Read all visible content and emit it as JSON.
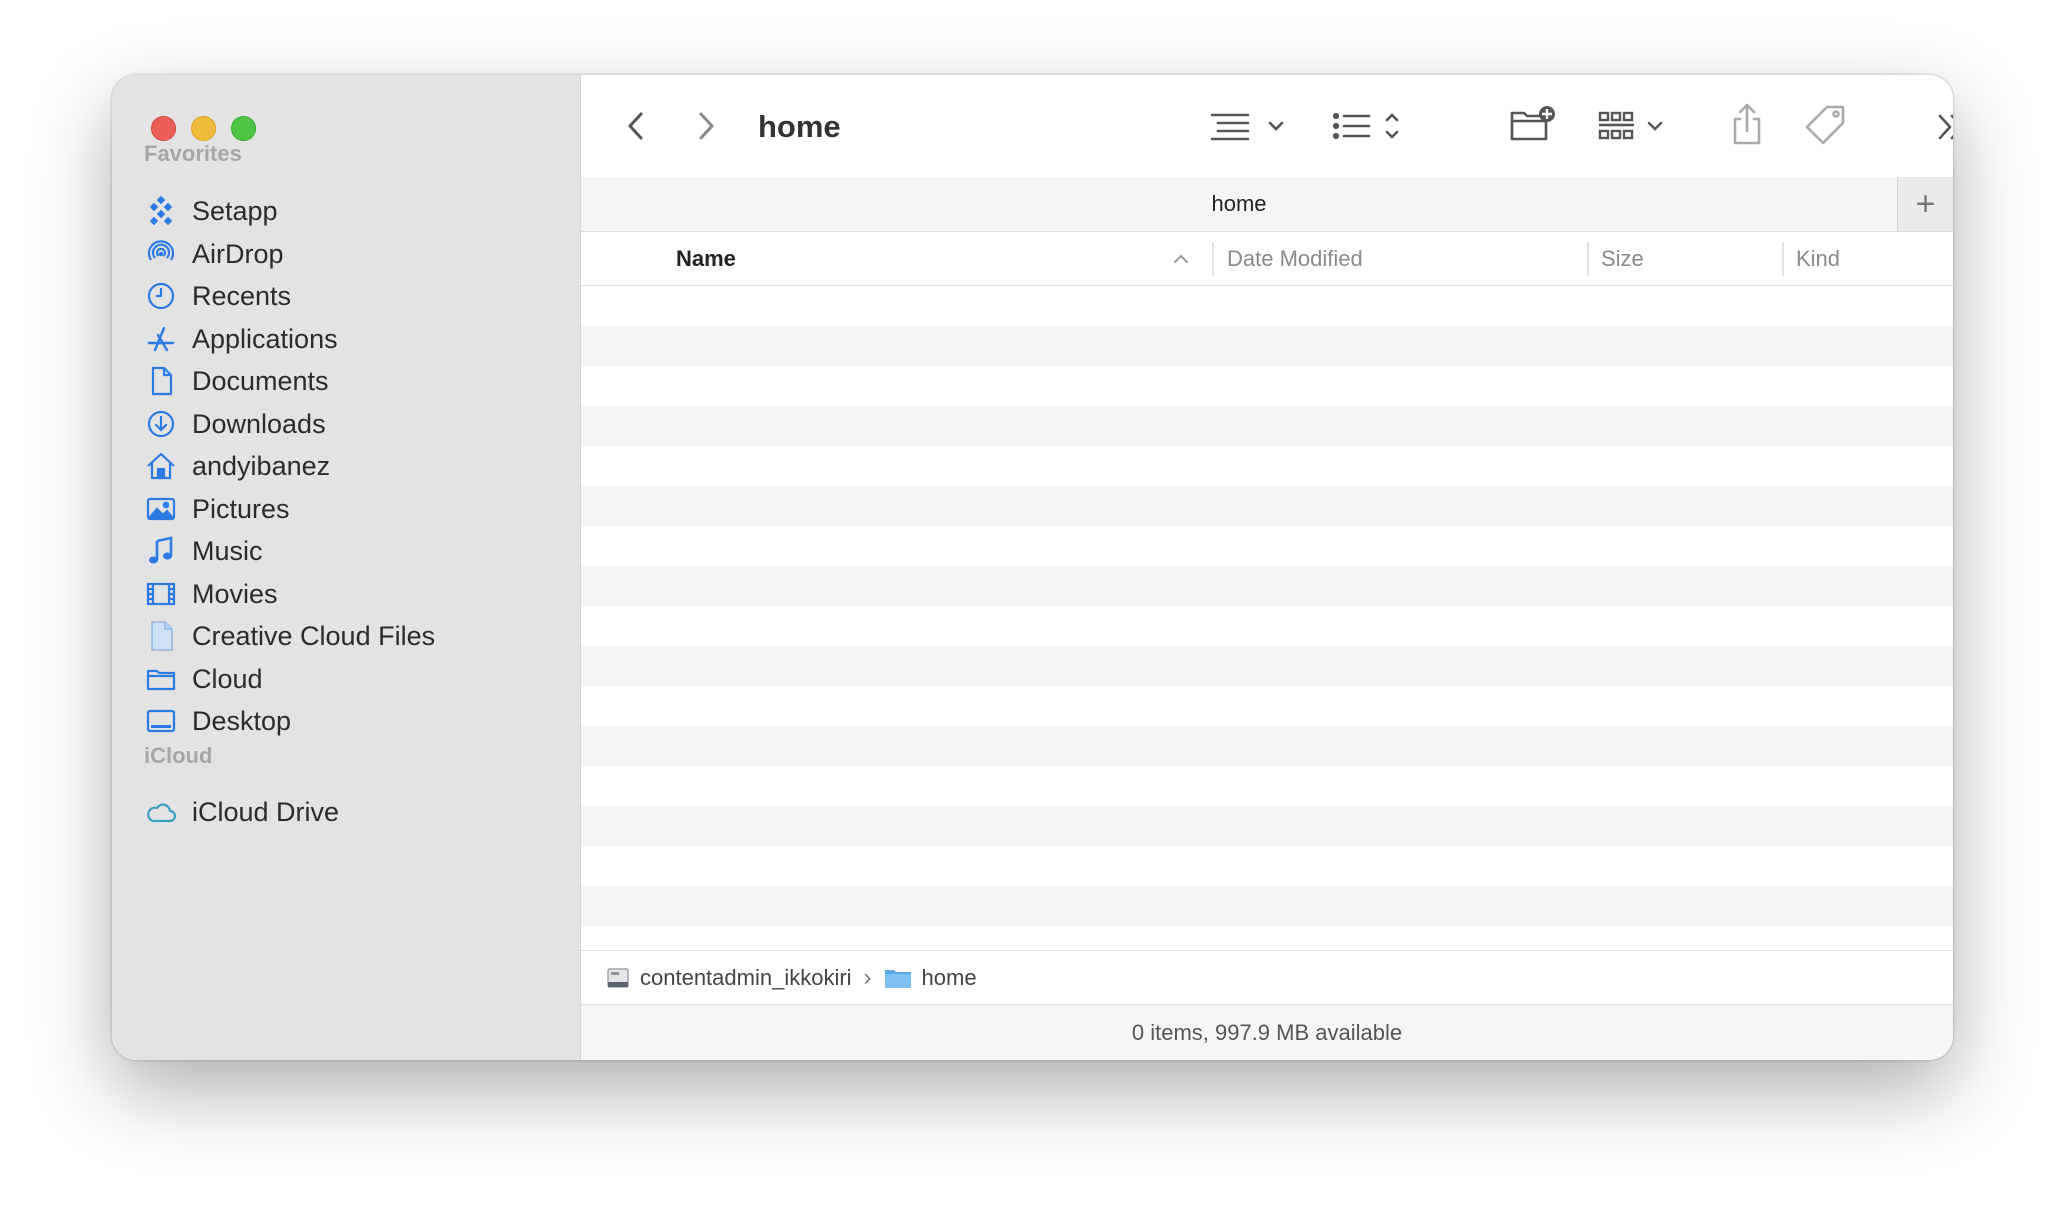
{
  "window": {
    "title": "home"
  },
  "sidebar": {
    "favorites_header": "Favorites",
    "favorites": [
      {
        "label": "Setapp",
        "icon": "setapp-icon"
      },
      {
        "label": "AirDrop",
        "icon": "airdrop-icon"
      },
      {
        "label": "Recents",
        "icon": "clock-icon"
      },
      {
        "label": "Applications",
        "icon": "applications-icon"
      },
      {
        "label": "Documents",
        "icon": "document-icon"
      },
      {
        "label": "Downloads",
        "icon": "download-icon"
      },
      {
        "label": "andyibanez",
        "icon": "home-icon"
      },
      {
        "label": "Pictures",
        "icon": "photo-icon"
      },
      {
        "label": "Music",
        "icon": "music-note-icon"
      },
      {
        "label": "Movies",
        "icon": "film-icon"
      },
      {
        "label": "Creative Cloud Files",
        "icon": "file-icon"
      },
      {
        "label": "Cloud",
        "icon": "folder-icon"
      },
      {
        "label": "Desktop",
        "icon": "desktop-icon"
      }
    ],
    "icloud_header": "iCloud",
    "icloud": [
      {
        "label": "iCloud Drive",
        "icon": "cloud-icon"
      }
    ]
  },
  "tabbar": {
    "tab_title": "home",
    "add_tab": "+"
  },
  "columns": {
    "name": "Name",
    "date_modified": "Date Modified",
    "size": "Size",
    "kind": "Kind"
  },
  "pathbar": {
    "volume": "contentadmin_ikkokiri",
    "separator": "›",
    "folder": "home"
  },
  "status": "0 items, 997.9 MB available",
  "colors": {
    "accent": "#2c7be5",
    "sidebar_bg": "#e3e3e3",
    "close": "#ec5f58",
    "minimize": "#f0bb3b",
    "maximize": "#4fc546"
  }
}
